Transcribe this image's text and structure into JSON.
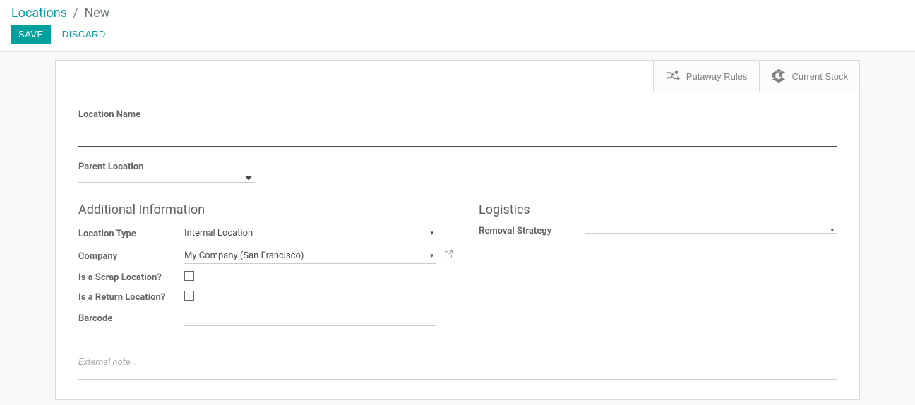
{
  "breadcrumb": {
    "parent": "Locations",
    "current": "New"
  },
  "actions": {
    "save": "Save",
    "discard": "Discard"
  },
  "stat_buttons": {
    "putaway": "Putaway Rules",
    "stock": "Current Stock"
  },
  "labels": {
    "location_name": "Location Name",
    "parent_location": "Parent Location",
    "additional_info": "Additional Information",
    "location_type": "Location Type",
    "company": "Company",
    "is_scrap": "Is a Scrap Location?",
    "is_return": "Is a Return Location?",
    "barcode": "Barcode",
    "logistics": "Logistics",
    "removal_strategy": "Removal Strategy"
  },
  "values": {
    "location_name": "",
    "parent_location": "",
    "location_type": "Internal Location",
    "company": "My Company (San Francisco)",
    "is_scrap": false,
    "is_return": false,
    "barcode": "",
    "removal_strategy": "",
    "note": ""
  },
  "placeholders": {
    "note": "External note..."
  }
}
